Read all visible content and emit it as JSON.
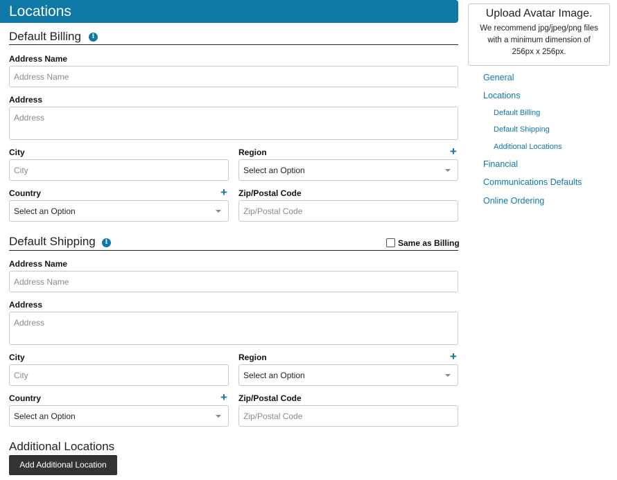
{
  "header": {
    "title": "Locations"
  },
  "billing": {
    "title": "Default Billing",
    "address_name": {
      "label": "Address Name",
      "placeholder": "Address Name"
    },
    "address": {
      "label": "Address",
      "placeholder": "Address"
    },
    "city": {
      "label": "City",
      "placeholder": "City"
    },
    "region": {
      "label": "Region",
      "value": "Select an Option"
    },
    "country": {
      "label": "Country",
      "value": "Select an Option"
    },
    "zip": {
      "label": "Zip/Postal Code",
      "placeholder": "Zip/Postal Code"
    }
  },
  "shipping": {
    "title": "Default Shipping",
    "same_as_billing": "Same as Billing",
    "address_name": {
      "label": "Address Name",
      "placeholder": "Address Name"
    },
    "address": {
      "label": "Address",
      "placeholder": "Address"
    },
    "city": {
      "label": "City",
      "placeholder": "City"
    },
    "region": {
      "label": "Region",
      "value": "Select an Option"
    },
    "country": {
      "label": "Country",
      "value": "Select an Option"
    },
    "zip": {
      "label": "Zip/Postal Code",
      "placeholder": "Zip/Postal Code"
    }
  },
  "additional": {
    "title": "Additional Locations",
    "button": "Add Additional Location"
  },
  "avatar": {
    "title": "Upload Avatar Image.",
    "description": "We recommend jpg/jpeg/png files with a minimum dimension of 256px x 256px."
  },
  "nav": {
    "general": "General",
    "locations": "Locations",
    "default_billing": "Default Billing",
    "default_shipping": "Default Shipping",
    "additional_locations": "Additional Locations",
    "financial": "Financial",
    "communications": "Communications Defaults",
    "online_ordering": "Online Ordering"
  },
  "icons": {
    "info": "info-icon",
    "plus": "plus-icon",
    "caret": "chevron-down-icon"
  },
  "colors": {
    "accent": "#0e78a7",
    "button": "#333333"
  }
}
